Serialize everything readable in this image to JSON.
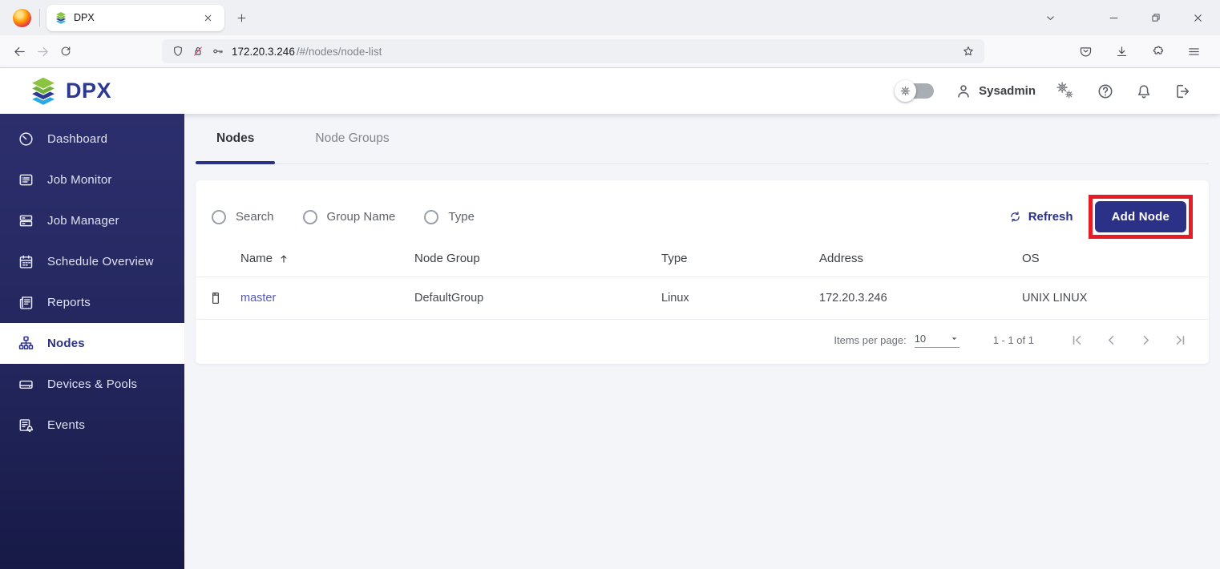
{
  "browser": {
    "tab_title": "DPX",
    "url_host": "172.20.3.246",
    "url_path": "/#/nodes/node-list"
  },
  "header": {
    "logo_text": "DPX",
    "username": "Sysadmin"
  },
  "sidebar": {
    "items": [
      {
        "label": "Dashboard",
        "icon": "gauge"
      },
      {
        "label": "Job Monitor",
        "icon": "list-panel"
      },
      {
        "label": "Job Manager",
        "icon": "stacked-rows"
      },
      {
        "label": "Schedule Overview",
        "icon": "calendar"
      },
      {
        "label": "Reports",
        "icon": "newspaper"
      },
      {
        "label": "Nodes",
        "icon": "sitemap",
        "active": true
      },
      {
        "label": "Devices & Pools",
        "icon": "drive"
      },
      {
        "label": "Events",
        "icon": "list-bell"
      }
    ]
  },
  "main": {
    "tabs": [
      {
        "label": "Nodes",
        "active": true
      },
      {
        "label": "Node Groups",
        "active": false
      }
    ],
    "filters": [
      {
        "label": "Search",
        "selected": false
      },
      {
        "label": "Group Name",
        "selected": false
      },
      {
        "label": "Type",
        "selected": false
      }
    ],
    "toolbar": {
      "refresh_label": "Refresh",
      "add_node_label": "Add Node"
    },
    "table": {
      "columns": [
        "Name",
        "Node Group",
        "Type",
        "Address",
        "OS"
      ],
      "sort": {
        "column": "Name",
        "direction": "asc"
      },
      "rows": [
        {
          "name": "master",
          "node_group": "DefaultGroup",
          "type": "Linux",
          "address": "172.20.3.246",
          "os": "UNIX LINUX"
        }
      ]
    },
    "pagination": {
      "items_per_page_label": "Items per page:",
      "items_per_page_value": "10",
      "range_label": "1 - 1 of 1"
    }
  },
  "colors": {
    "brand_navy": "#2b3187",
    "logo_navy": "#2b3990",
    "logo_green": "#8bc53f",
    "logo_teal": "#27aae1",
    "sidebar_top": "#2c2f6d",
    "sidebar_bottom": "#171a46",
    "link_blue": "#5457c8",
    "annotation_red": "#e81c24",
    "content_bg": "#f4f5f9"
  },
  "icons": {
    "firefox": "orange-gradient-circle",
    "dpx-logo": "stacked-layer-chevrons",
    "shield": "outline-shield",
    "lock-insecure": "padlock-red-slash",
    "key": "key-outline",
    "bookmark-star": "star-outline",
    "pocket": "badge-chevron-down",
    "download": "arrow-down-tray",
    "extensions": "puzzle-piece",
    "menu": "hamburger-lines",
    "settings-toggle": "gear-knob-switch-off",
    "user": "person-outline",
    "settings": "double-gears",
    "help": "question-circle",
    "notifications": "bell-outline",
    "logout": "bracket-arrow-right",
    "node-row": "server-tower",
    "sort-asc": "arrow-up",
    "items-per-page": "caret-down",
    "pager": "first/prev/next/last chevrons"
  }
}
